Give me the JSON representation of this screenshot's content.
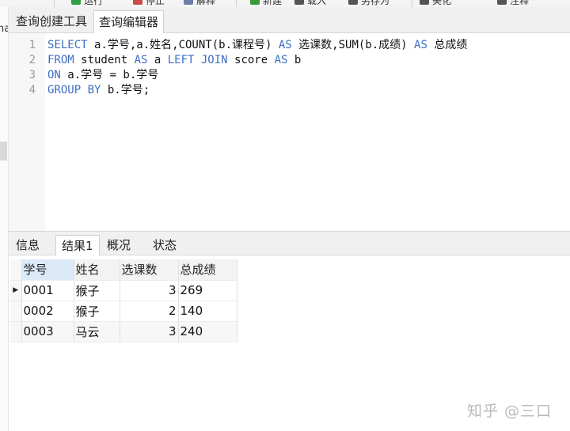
{
  "toolbar": {
    "items": [
      {
        "label": "运行",
        "icon": "run-icon",
        "color": "#2e9e44"
      },
      {
        "label": "停止",
        "icon": "stop-icon",
        "color": "#c94a4a"
      },
      {
        "label": "解释",
        "icon": "explain-icon",
        "color": "#6b7fa8"
      },
      {
        "label": "新建",
        "icon": "new-icon",
        "color": "#3a9a3a"
      },
      {
        "label": "载入",
        "icon": "load-icon",
        "color": "#555555"
      },
      {
        "label": "另存为",
        "icon": "saveas-icon",
        "color": "#555555"
      },
      {
        "label": "美化",
        "icon": "beautify-icon",
        "color": "#555555"
      },
      {
        "label": "注释",
        "icon": "comment-icon",
        "color": "#555555"
      }
    ]
  },
  "left_panel": {
    "text": "na"
  },
  "main_tabs": [
    {
      "label": "查询创建工具"
    },
    {
      "label": "查询编辑器",
      "active": true
    }
  ],
  "editor": {
    "lines": [
      {
        "no": "1",
        "tokens": [
          {
            "t": "SELECT",
            "kw": true
          },
          {
            "t": " a.学号,a.姓名,COUNT(b.课程号) ",
            "kw": false
          },
          {
            "t": "AS",
            "kw": true
          },
          {
            "t": " 选课数,SUM(b.成绩) ",
            "kw": false
          },
          {
            "t": "AS",
            "kw": true
          },
          {
            "t": " 总成绩",
            "kw": false
          }
        ]
      },
      {
        "no": "2",
        "tokens": [
          {
            "t": "FROM",
            "kw": true
          },
          {
            "t": " student ",
            "kw": false
          },
          {
            "t": "AS",
            "kw": true
          },
          {
            "t": " a ",
            "kw": false
          },
          {
            "t": "LEFT JOIN",
            "kw": true
          },
          {
            "t": " score ",
            "kw": false
          },
          {
            "t": "AS",
            "kw": true
          },
          {
            "t": " b",
            "kw": false
          }
        ]
      },
      {
        "no": "3",
        "tokens": [
          {
            "t": "ON",
            "kw": true
          },
          {
            "t": " a.学号 = b.学号",
            "kw": false
          }
        ]
      },
      {
        "no": "4",
        "tokens": [
          {
            "t": "GROUP BY",
            "kw": true
          },
          {
            "t": " b.学号;",
            "kw": false
          }
        ]
      }
    ],
    "keyword_color": "#3d6fc4"
  },
  "result_tabs": [
    {
      "label": "信息"
    },
    {
      "label": "结果1",
      "active": true
    },
    {
      "label": "概况"
    },
    {
      "label": "状态"
    }
  ],
  "grid": {
    "columns": [
      "学号",
      "姓名",
      "选课数",
      "总成绩"
    ],
    "rows": [
      [
        "0001",
        "猴子",
        "3",
        "269"
      ],
      [
        "0002",
        "猴子",
        "2",
        "140"
      ],
      [
        "0003",
        "马云",
        "3",
        "240"
      ]
    ],
    "selected_row": 0,
    "selected_header": 0,
    "row_indicator": "▶"
  },
  "watermark": "知乎 @三口"
}
